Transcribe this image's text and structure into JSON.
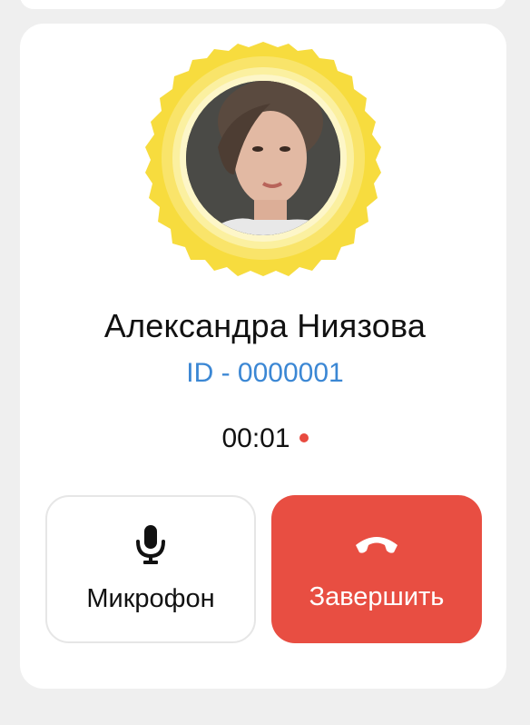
{
  "contact": {
    "name": "Александра Ниязова",
    "id_text": "ID - 0000001"
  },
  "call": {
    "timer": "00:01",
    "recording_indicator_color": "#e84a3f"
  },
  "controls": {
    "mic_label": "Микрофон",
    "mic_icon": "microphone-icon",
    "end_label": "Завершить",
    "end_icon": "phone-hangup-icon"
  },
  "colors": {
    "accent_blue": "#3b87d4",
    "end_call_red": "#e84e42",
    "avatar_ring_yellow": "#f7dc3e",
    "background": "#efefef"
  }
}
